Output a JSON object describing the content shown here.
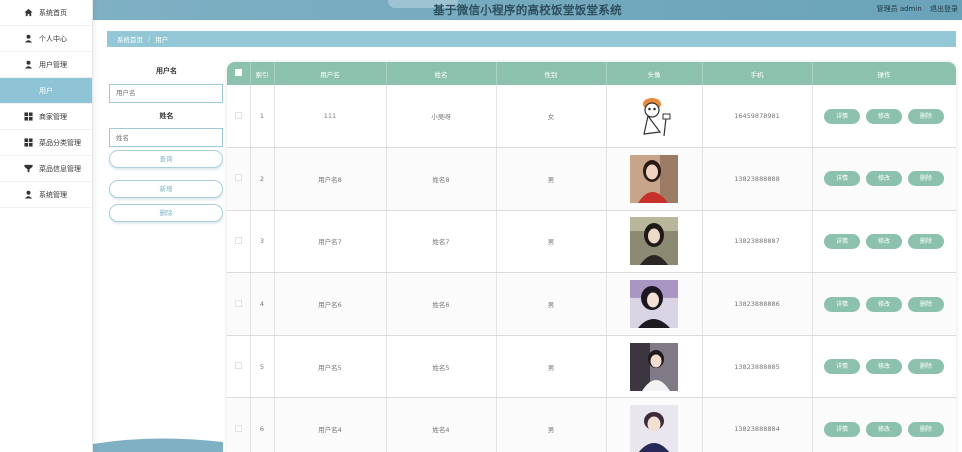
{
  "header": {
    "title": "基于微信小程序的高校饭堂饭堂系统",
    "admin_label": "管理员 admin",
    "logout_label": "退出登录"
  },
  "sidebar": {
    "items": [
      {
        "label": "系统首页",
        "icon": "home-icon"
      },
      {
        "label": "个人中心",
        "icon": "user-icon"
      },
      {
        "label": "用户管理",
        "icon": "user-icon"
      },
      {
        "label": "用户",
        "icon": ""
      },
      {
        "label": "商家管理",
        "icon": "grid-icon"
      },
      {
        "label": "菜品分类管理",
        "icon": "grid-icon"
      },
      {
        "label": "菜品信息管理",
        "icon": "cup-icon"
      },
      {
        "label": "系统管理",
        "icon": "user-icon"
      }
    ]
  },
  "breadcrumb": {
    "home": "系统首页",
    "sep": "/",
    "current": "用户"
  },
  "search": {
    "username_label": "用户名",
    "username_placeholder": "用户名",
    "name_label": "姓名",
    "name_placeholder": "姓名",
    "query_label": "查询",
    "add_label": "新增",
    "delete_label": "删除"
  },
  "table": {
    "headers": [
      "",
      "索引",
      "用户名",
      "姓名",
      "性别",
      "头像",
      "手机",
      "操作"
    ],
    "ops": {
      "detail": "详情",
      "edit": "修改",
      "delete": "删除"
    },
    "rows": [
      {
        "index": "1",
        "username": "111",
        "name": "小吴呀",
        "gender": "女",
        "phone": "16459878981",
        "avatar": "sketch"
      },
      {
        "index": "2",
        "username": "用户名8",
        "name": "姓名8",
        "gender": "男",
        "phone": "13823888888",
        "avatar": "red"
      },
      {
        "index": "3",
        "username": "用户名7",
        "name": "姓名7",
        "gender": "男",
        "phone": "13823888887",
        "avatar": "dark"
      },
      {
        "index": "4",
        "username": "用户名6",
        "name": "姓名6",
        "gender": "男",
        "phone": "13823888886",
        "avatar": "purple"
      },
      {
        "index": "5",
        "username": "用户名5",
        "name": "姓名5",
        "gender": "男",
        "phone": "13823888885",
        "avatar": "white"
      },
      {
        "index": "6",
        "username": "用户名4",
        "name": "姓名4",
        "gender": "男",
        "phone": "13823888884",
        "avatar": "navy"
      }
    ]
  },
  "colors": {
    "accent": "#8cc2ad",
    "header": "#6aa3b9",
    "breadcrumb": "#94c7d6",
    "sidebar_active": "#8fc4d6"
  }
}
